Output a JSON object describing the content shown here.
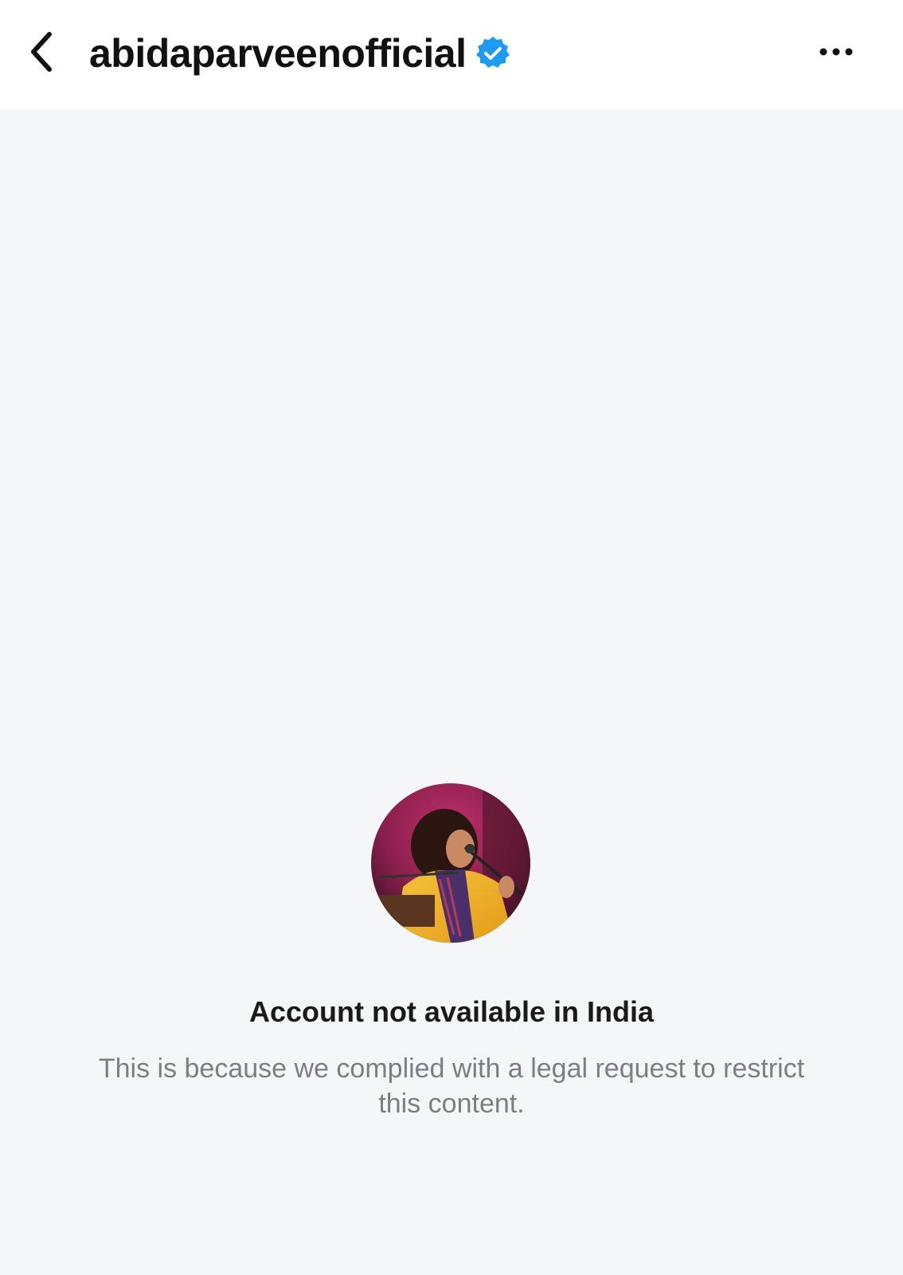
{
  "header": {
    "username": "abidaparveenofficial",
    "back_icon": "chevron-left-icon",
    "verified_icon": "verified-badge-icon",
    "more_icon": "more-horizontal-icon",
    "verified_color": "#1d9bf0"
  },
  "restriction": {
    "avatar_icon": "profile-avatar",
    "title": "Account not available in India",
    "message": "This is because we complied with a legal request to restrict this content."
  },
  "colors": {
    "background": "#f5f6f7",
    "header_background": "#ffffff",
    "title_text": "#1a1a1a",
    "message_text": "#7a7f86"
  }
}
